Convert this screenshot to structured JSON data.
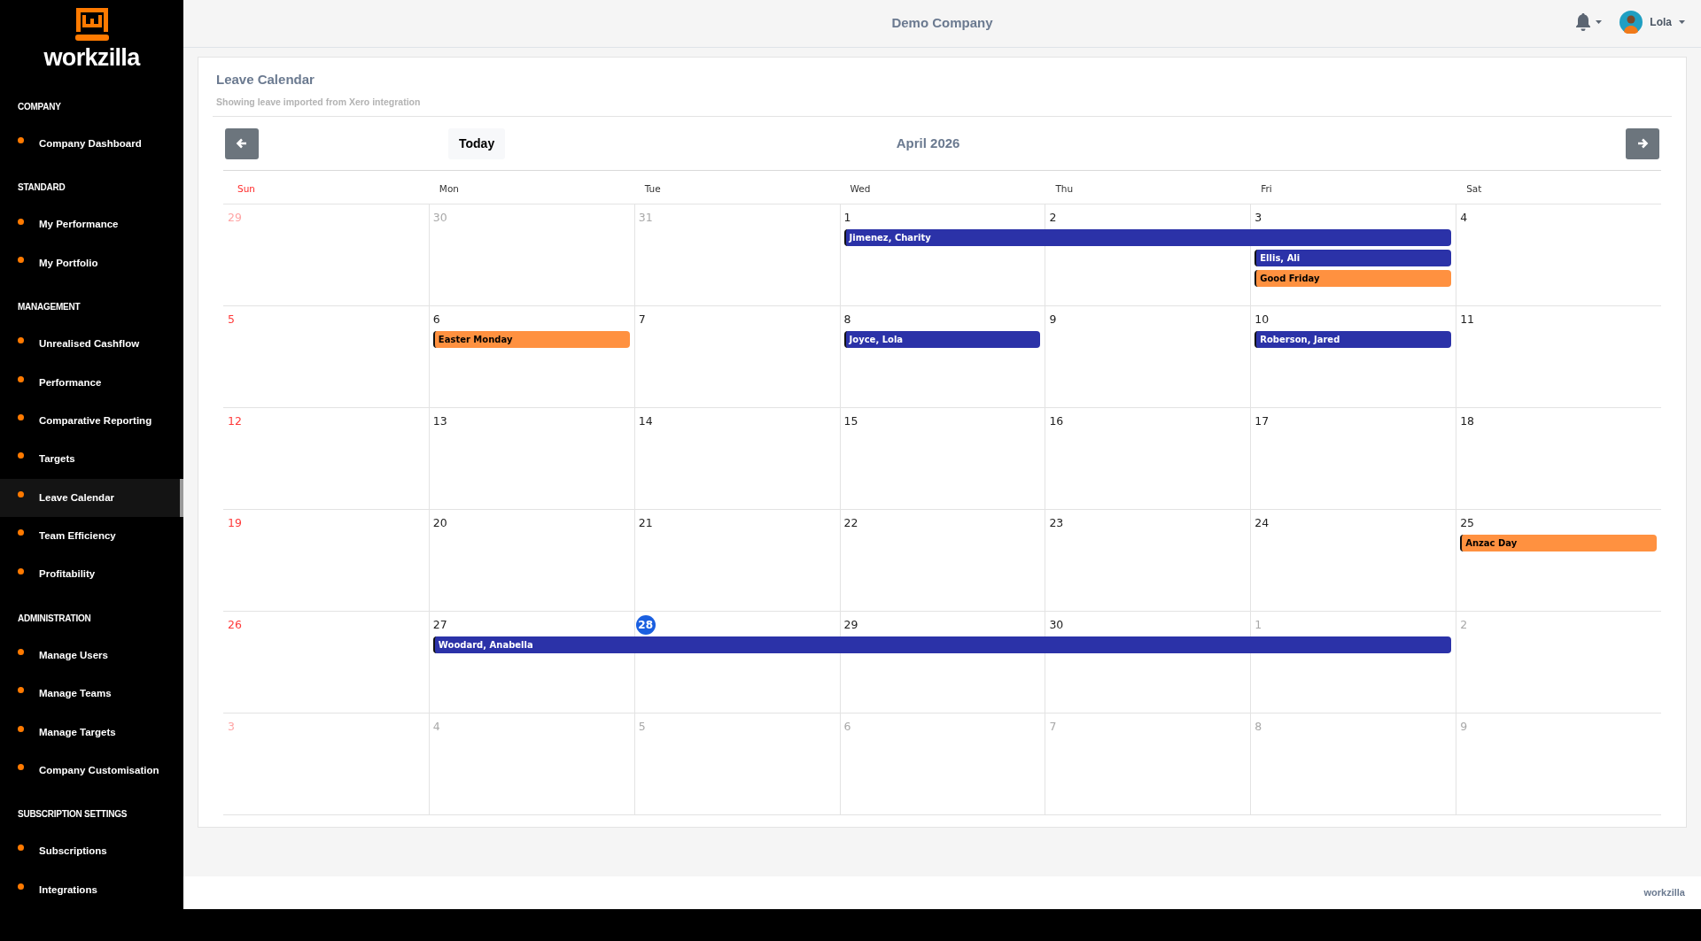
{
  "sidebar": {
    "logo_text": "workzilla",
    "sections": [
      {
        "heading": "COMPANY",
        "items": [
          {
            "label": "Company Dashboard",
            "selected": false
          }
        ]
      },
      {
        "heading": "STANDARD",
        "items": [
          {
            "label": "My Performance",
            "selected": false
          },
          {
            "label": "My Portfolio",
            "selected": false
          }
        ]
      },
      {
        "heading": "MANAGEMENT",
        "items": [
          {
            "label": "Unrealised Cashflow",
            "selected": false
          },
          {
            "label": "Performance",
            "selected": false
          },
          {
            "label": "Comparative Reporting",
            "selected": false
          },
          {
            "label": "Targets",
            "selected": false
          },
          {
            "label": "Leave Calendar",
            "selected": true
          },
          {
            "label": "Team Efficiency",
            "selected": false
          },
          {
            "label": "Profitability",
            "selected": false
          }
        ]
      },
      {
        "heading": "ADMINISTRATION",
        "items": [
          {
            "label": "Manage Users",
            "selected": false
          },
          {
            "label": "Manage Teams",
            "selected": false
          },
          {
            "label": "Manage Targets",
            "selected": false
          },
          {
            "label": "Company Customisation",
            "selected": false
          }
        ]
      },
      {
        "heading": "SUBSCRIPTION SETTINGS",
        "items": [
          {
            "label": "Subscriptions",
            "selected": false
          },
          {
            "label": "Integrations",
            "selected": false
          }
        ]
      }
    ]
  },
  "header": {
    "company": "Demo Company",
    "user": "Lola"
  },
  "card": {
    "title": "Leave Calendar",
    "subtitle": "Showing leave imported from Xero integration"
  },
  "calendar": {
    "today_button": "Today",
    "month": "April 2026",
    "weekdays": [
      {
        "label": "Sun",
        "highlight": true
      },
      {
        "label": "Mon",
        "highlight": false
      },
      {
        "label": "Tue",
        "highlight": false
      },
      {
        "label": "Wed",
        "highlight": false
      },
      {
        "label": "Thu",
        "highlight": false
      },
      {
        "label": "Fri",
        "highlight": false
      },
      {
        "label": "Sat",
        "highlight": false
      }
    ],
    "weeks": [
      {
        "days": [
          {
            "label": "29",
            "in_month": false
          },
          {
            "label": "30",
            "in_month": false
          },
          {
            "label": "31",
            "in_month": false
          },
          {
            "label": "1",
            "in_month": true,
            "events": [
              {
                "label": "Jimenez, Charity",
                "kind": "leave",
                "continues": true
              }
            ]
          },
          {
            "label": "2",
            "in_month": true,
            "events": [
              {
                "kind": "leave",
                "continues": true
              }
            ]
          },
          {
            "label": "3",
            "in_month": true,
            "events": [
              {
                "kind": "leave",
                "continues": false
              },
              {
                "label": "Ellis, Ali",
                "kind": "leave",
                "continues": false
              },
              {
                "label": "Good Friday",
                "kind": "holiday",
                "continues": false
              }
            ]
          },
          {
            "label": "4",
            "in_month": true
          }
        ]
      },
      {
        "days": [
          {
            "label": "5",
            "in_month": true
          },
          {
            "label": "6",
            "in_month": true,
            "events": [
              {
                "label": "Easter Monday",
                "kind": "holiday",
                "continues": false
              }
            ]
          },
          {
            "label": "7",
            "in_month": true
          },
          {
            "label": "8",
            "in_month": true,
            "events": [
              {
                "label": "Joyce, Lola",
                "kind": "leave",
                "continues": false
              }
            ]
          },
          {
            "label": "9",
            "in_month": true
          },
          {
            "label": "10",
            "in_month": true,
            "events": [
              {
                "label": "Roberson, Jared",
                "kind": "leave",
                "continues": false
              }
            ]
          },
          {
            "label": "11",
            "in_month": true
          }
        ]
      },
      {
        "days": [
          {
            "label": "12",
            "in_month": true
          },
          {
            "label": "13",
            "in_month": true
          },
          {
            "label": "14",
            "in_month": true
          },
          {
            "label": "15",
            "in_month": true
          },
          {
            "label": "16",
            "in_month": true
          },
          {
            "label": "17",
            "in_month": true
          },
          {
            "label": "18",
            "in_month": true
          }
        ]
      },
      {
        "days": [
          {
            "label": "19",
            "in_month": true
          },
          {
            "label": "20",
            "in_month": true
          },
          {
            "label": "21",
            "in_month": true
          },
          {
            "label": "22",
            "in_month": true
          },
          {
            "label": "23",
            "in_month": true
          },
          {
            "label": "24",
            "in_month": true
          },
          {
            "label": "25",
            "in_month": true,
            "events": [
              {
                "label": "Anzac Day",
                "kind": "holiday",
                "continues": false
              }
            ]
          }
        ]
      },
      {
        "days": [
          {
            "label": "26",
            "in_month": true
          },
          {
            "label": "27",
            "in_month": true,
            "events": [
              {
                "label": "Woodard, Anabella",
                "kind": "leave",
                "continues": true
              }
            ]
          },
          {
            "label": "28",
            "in_month": true,
            "today": true,
            "events": [
              {
                "kind": "leave",
                "continues": true
              }
            ]
          },
          {
            "label": "29",
            "in_month": true,
            "events": [
              {
                "kind": "leave",
                "continues": true
              }
            ]
          },
          {
            "label": "30",
            "in_month": true,
            "events": [
              {
                "kind": "leave",
                "continues": true
              }
            ]
          },
          {
            "label": "1",
            "in_month": false,
            "events": [
              {
                "kind": "leave",
                "continues": false
              }
            ]
          },
          {
            "label": "2",
            "in_month": false
          }
        ]
      },
      {
        "days": [
          {
            "label": "3",
            "in_month": false
          },
          {
            "label": "4",
            "in_month": false
          },
          {
            "label": "5",
            "in_month": false
          },
          {
            "label": "6",
            "in_month": false
          },
          {
            "label": "7",
            "in_month": false
          },
          {
            "label": "8",
            "in_month": false
          },
          {
            "label": "9",
            "in_month": false
          }
        ]
      }
    ]
  },
  "footer": {
    "brand": "workzilla"
  }
}
